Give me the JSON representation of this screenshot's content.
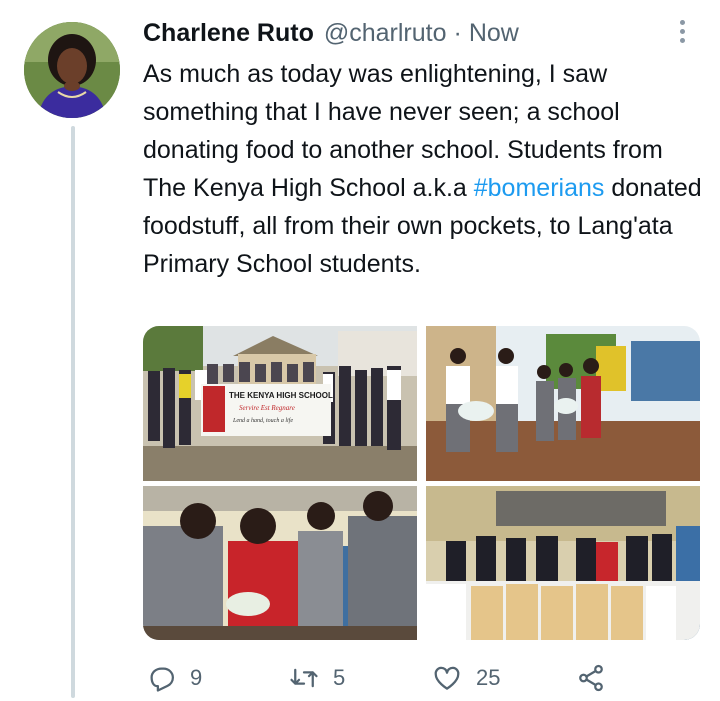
{
  "tweet": {
    "author_name": "Charlene Ruto",
    "handle": "@charlruto",
    "separator": "·",
    "time": "Now",
    "text_before": "As much as today was enlightening, I saw something that I have never seen; a school donating food to another school. Students from The Kenya High School a.k.a ",
    "hashtag": "#bomerians",
    "text_after": " donated foodstuff, all from their own pockets, to Lang'ata Primary School students."
  },
  "media": {
    "banner_title": "THE KENYA HIGH SCHOOL",
    "banner_motto": "Servire Est Regnare",
    "banner_slogan": "Lend a hand, touch a life"
  },
  "actions": {
    "replies": "9",
    "retweets": "5",
    "likes": "25"
  },
  "colors": {
    "link": "#1d9bf0",
    "secondary_text": "#536471",
    "thread_line": "#cfd9de"
  },
  "icons": [
    "more-icon",
    "reply-icon",
    "retweet-icon",
    "like-icon",
    "share-icon"
  ]
}
